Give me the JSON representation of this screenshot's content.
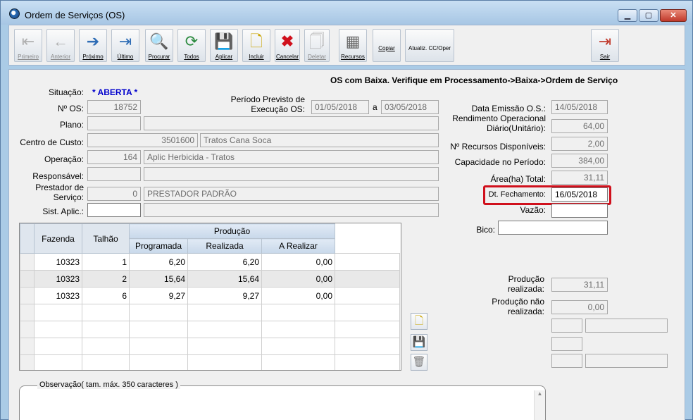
{
  "window": {
    "title": "Ordem de Serviços (OS)",
    "minimize": "▁",
    "restore": "▢",
    "close": "✕"
  },
  "toolbar": {
    "primeiro": "Primeiro",
    "anterior": "Anterior",
    "proximo": "Próximo",
    "ultimo": "Último",
    "procurar": "Procurar",
    "todos": "Todos",
    "aplicar": "Aplicar",
    "incluir": "Incluir",
    "cancelar": "Cancelar",
    "deletar": "Deletar",
    "recursos": "Recursos",
    "copiar": "Copiar",
    "atualiz": "Atualiz. CC/Oper",
    "sair": "Sair"
  },
  "banner": "OS com Baixa. Verifique em Processamento->Baixa->Ordem de Serviço",
  "form": {
    "situacao_label": "Situação:",
    "situacao_value": "* ABERTA *",
    "nos_label": "Nº OS:",
    "nos_value": "18752",
    "periodo_label1": "Período Previsto de",
    "periodo_label2": "Execução OS:",
    "periodo_from": "01/05/2018",
    "periodo_sep": "a",
    "periodo_to": "03/05/2018",
    "plano_label": "Plano:",
    "plano_code": "",
    "plano_desc": "",
    "centro_label": "Centro de Custo:",
    "centro_code": "3501600",
    "centro_desc": "Tratos Cana Soca",
    "operacao_label": "Operação:",
    "operacao_code": "164",
    "operacao_desc": "Aplic Herbicida - Tratos",
    "responsavel_label": "Responsável:",
    "responsavel_code": "",
    "responsavel_desc": "",
    "prestador_label1": "Prestador de",
    "prestador_label2": "Serviço:",
    "prestador_code": "0",
    "prestador_desc": "PRESTADOR PADRÃO",
    "sist_label": "Sist. Aplic.:",
    "sist_code": "",
    "sist_desc": ""
  },
  "right": {
    "data_emissao_label": "Data Emissão O.S.:",
    "data_emissao_value": "14/05/2018",
    "rend_label1": "Rendimento Operacional",
    "rend_label2": "Diário(Unitário):",
    "rend_value": "64,00",
    "recursos_label": "Nº Recursos Disponíveis:",
    "recursos_value": "2,00",
    "capacidade_label": "Capacidade no Período:",
    "capacidade_value": "384,00",
    "area_label": "Área(ha) Total:",
    "area_value": "31,11",
    "dt_fech_label": "Dt. Fechamento:",
    "dt_fech_value": "16/05/2018",
    "vazao_label": "Vazão:",
    "vazao_value": "",
    "bico_label": "Bico:",
    "bico_value": "",
    "prod_real_label1": "Produção",
    "prod_real_label2": "realizada:",
    "prod_real_value": "31,11",
    "prod_nreal_label1": "Produção não",
    "prod_nreal_label2": "realizada:",
    "prod_nreal_value": "0,00"
  },
  "grid": {
    "headers": {
      "fazenda": "Fazenda",
      "talhao": "Talhão",
      "producao": "Produção",
      "programada": "Programada",
      "realizada": "Realizada",
      "a_realizar": "A Realizar"
    },
    "rows": [
      {
        "fazenda": "10323",
        "talhao": "1",
        "programada": "6,20",
        "realizada": "6,20",
        "a_realizar": "0,00"
      },
      {
        "fazenda": "10323",
        "talhao": "2",
        "programada": "15,64",
        "realizada": "15,64",
        "a_realizar": "0,00"
      },
      {
        "fazenda": "10323",
        "talhao": "6",
        "programada": "9,27",
        "realizada": "9,27",
        "a_realizar": "0,00"
      }
    ]
  },
  "observacao_label": "Observação( tam. máx. 350 caracteres )",
  "colors": {
    "highlight_border": "#d0101c",
    "situacao": "#0000cc",
    "title_bg": "#aacbe6"
  }
}
